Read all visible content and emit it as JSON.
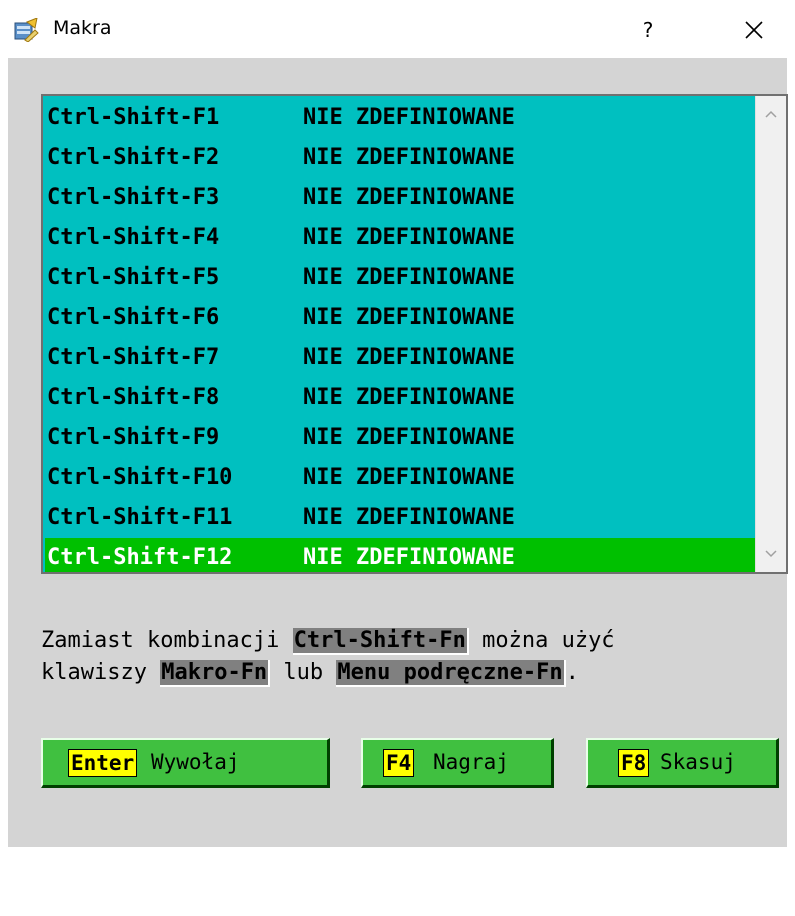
{
  "window": {
    "title": "Makra",
    "help_label": "?",
    "app_icon": "makra-app-icon",
    "close_icon": "close-icon"
  },
  "macros": [
    {
      "key": "Ctrl-Shift-F1",
      "status": "NIE ZDEFINIOWANE",
      "selected": false
    },
    {
      "key": "Ctrl-Shift-F2",
      "status": "NIE ZDEFINIOWANE",
      "selected": false
    },
    {
      "key": "Ctrl-Shift-F3",
      "status": "NIE ZDEFINIOWANE",
      "selected": false
    },
    {
      "key": "Ctrl-Shift-F4",
      "status": "NIE ZDEFINIOWANE",
      "selected": false
    },
    {
      "key": "Ctrl-Shift-F5",
      "status": "NIE ZDEFINIOWANE",
      "selected": false
    },
    {
      "key": "Ctrl-Shift-F6",
      "status": "NIE ZDEFINIOWANE",
      "selected": false
    },
    {
      "key": "Ctrl-Shift-F7",
      "status": "NIE ZDEFINIOWANE",
      "selected": false
    },
    {
      "key": "Ctrl-Shift-F8",
      "status": "NIE ZDEFINIOWANE",
      "selected": false
    },
    {
      "key": "Ctrl-Shift-F9",
      "status": "NIE ZDEFINIOWANE",
      "selected": false
    },
    {
      "key": "Ctrl-Shift-F10",
      "status": "NIE ZDEFINIOWANE",
      "selected": false
    },
    {
      "key": "Ctrl-Shift-F11",
      "status": "NIE ZDEFINIOWANE",
      "selected": false
    },
    {
      "key": "Ctrl-Shift-F12",
      "status": "NIE ZDEFINIOWANE",
      "selected": true
    }
  ],
  "hint": {
    "line1_prefix": "Zamiast kombinacji ",
    "line1_key": "Ctrl-Shift-Fn",
    "line1_suffix": " można użyć",
    "line2_prefix": "klawiszy ",
    "line2_key1": "Makro-Fn",
    "line2_middle": " lub ",
    "line2_key2": "Menu podręczne-Fn",
    "line2_suffix": "."
  },
  "buttons": {
    "call": {
      "key": "Enter",
      "label": "Wywołaj"
    },
    "record": {
      "key": "F4",
      "label": "Nagraj"
    },
    "delete": {
      "key": "F8",
      "label": "Skasuj"
    }
  },
  "colors": {
    "list_background": "#00c0c0",
    "selection": "#00c000",
    "button": "#40c040",
    "key_highlight": "#ffff00",
    "dialog_background": "#d4d4d4"
  }
}
